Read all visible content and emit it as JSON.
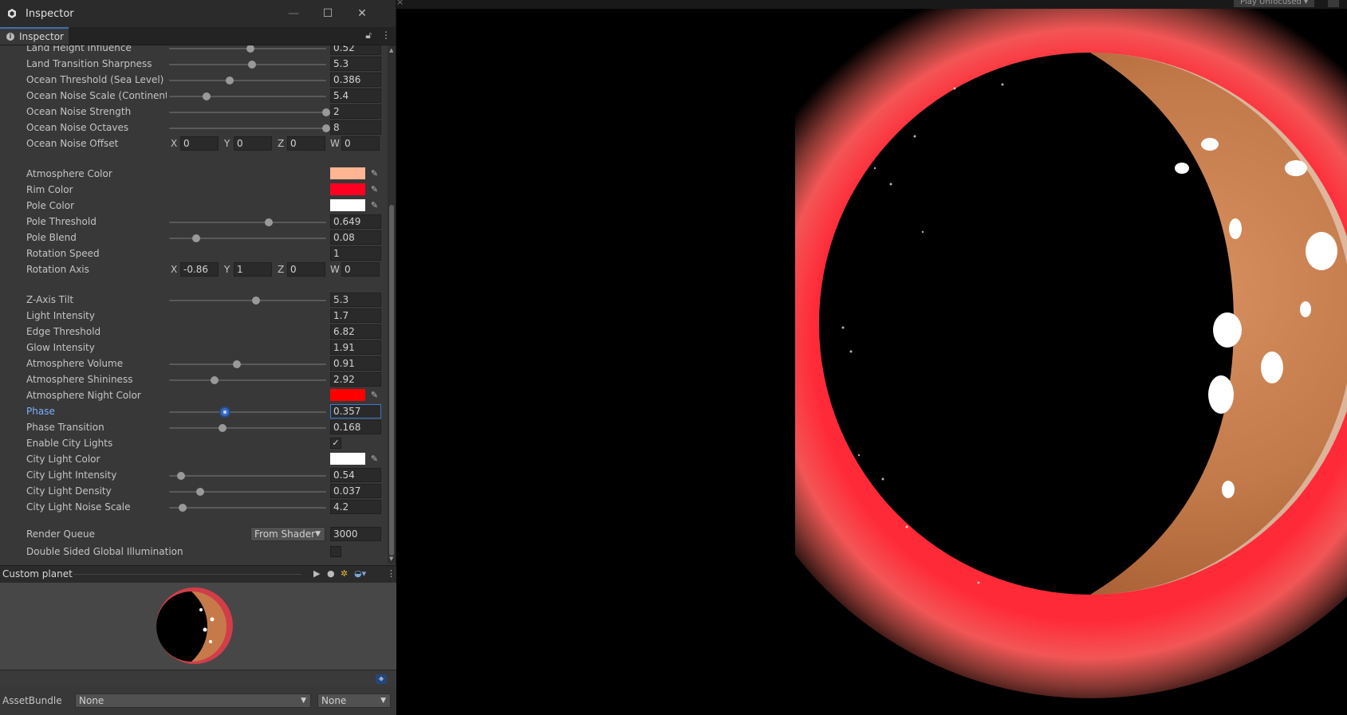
{
  "window": {
    "title": "Inspector",
    "tab_label": "Inspector",
    "minimize_glyph": "—",
    "maximize_glyph": "☐",
    "close_glyph": "✕"
  },
  "game_view": {
    "play_mode_label": "Play Unfocused ▾"
  },
  "properties": {
    "land_height_influence": {
      "label": "Land Height Influence",
      "value": "0.52",
      "slider": 0.52
    },
    "land_transition_sharpness": {
      "label": "Land Transition Sharpness",
      "value": "5.3",
      "slider": 0.53
    },
    "ocean_threshold": {
      "label": "Ocean Threshold (Sea Level)",
      "value": "0.386",
      "slider": 0.386
    },
    "ocean_noise_scale": {
      "label": "Ocean Noise Scale (Continent Size)",
      "value": "5.4",
      "slider": 0.24
    },
    "ocean_noise_strength": {
      "label": "Ocean Noise Strength",
      "value": "2",
      "slider": 1.0
    },
    "ocean_noise_octaves": {
      "label": "Ocean Noise Octaves",
      "value": "8",
      "slider": 1.0
    },
    "ocean_noise_offset": {
      "label": "Ocean Noise Offset",
      "x": "0",
      "y": "0",
      "z": "0",
      "w": "0"
    },
    "atmosphere_color": {
      "label": "Atmosphere Color",
      "color": "#FFB592"
    },
    "rim_color": {
      "label": "Rim Color",
      "color": "#FF0022"
    },
    "pole_color": {
      "label": "Pole Color",
      "color": "#FFFFFF"
    },
    "pole_threshold": {
      "label": "Pole Threshold",
      "value": "0.649",
      "slider": 0.637
    },
    "pole_blend": {
      "label": "Pole Blend",
      "value": "0.08",
      "slider": 0.175
    },
    "rotation_speed": {
      "label": "Rotation Speed",
      "value": "1"
    },
    "rotation_axis": {
      "label": "Rotation Axis",
      "x": "-0.86",
      "y": "1",
      "z": "0",
      "w": "0"
    },
    "z_axis_tilt": {
      "label": "Z-Axis Tilt",
      "value": "5.3",
      "slider": 0.555
    },
    "light_intensity": {
      "label": "Light Intensity",
      "value": "1.7"
    },
    "edge_threshold": {
      "label": "Edge Threshold",
      "value": "6.82"
    },
    "glow_intensity": {
      "label": "Glow Intensity",
      "value": "1.91"
    },
    "atmosphere_volume": {
      "label": "Atmosphere Volume",
      "value": "0.91",
      "slider": 0.43
    },
    "atmosphere_shininess": {
      "label": "Atmosphere Shininess",
      "value": "2.92",
      "slider": 0.29
    },
    "atmosphere_night_color": {
      "label": "Atmosphere Night Color",
      "color": "#FF0000"
    },
    "phase": {
      "label": "Phase",
      "value": "0.357",
      "slider": 0.357
    },
    "phase_transition": {
      "label": "Phase Transition",
      "value": "0.168",
      "slider": 0.34
    },
    "enable_city_lights": {
      "label": "Enable City Lights",
      "checked": "✓"
    },
    "city_light_color": {
      "label": "City Light Color",
      "color": "#FFFFFF"
    },
    "city_light_intensity": {
      "label": "City Light Intensity",
      "value": "0.54",
      "slider": 0.075
    },
    "city_light_density": {
      "label": "City Light Density",
      "value": "0.037",
      "slider": 0.2
    },
    "city_light_noise_scale": {
      "label": "City Light Noise Scale",
      "value": "4.2",
      "slider": 0.085
    },
    "render_queue": {
      "label": "Render Queue",
      "mode": "From Shader",
      "value": "3000"
    },
    "double_sided_gi": {
      "label": "Double Sided Global Illumination",
      "checked": ""
    }
  },
  "axis_labels": {
    "x": "X",
    "y": "Y",
    "z": "Z",
    "w": "W"
  },
  "preview": {
    "title": "Custom planet"
  },
  "asset_bundle": {
    "label": "AssetBundle",
    "name": "None",
    "variant": "None"
  },
  "colors": {
    "accent": "#3a72b0",
    "atmosphere_glow": "#FF4A4A",
    "surface": "#C07848"
  }
}
